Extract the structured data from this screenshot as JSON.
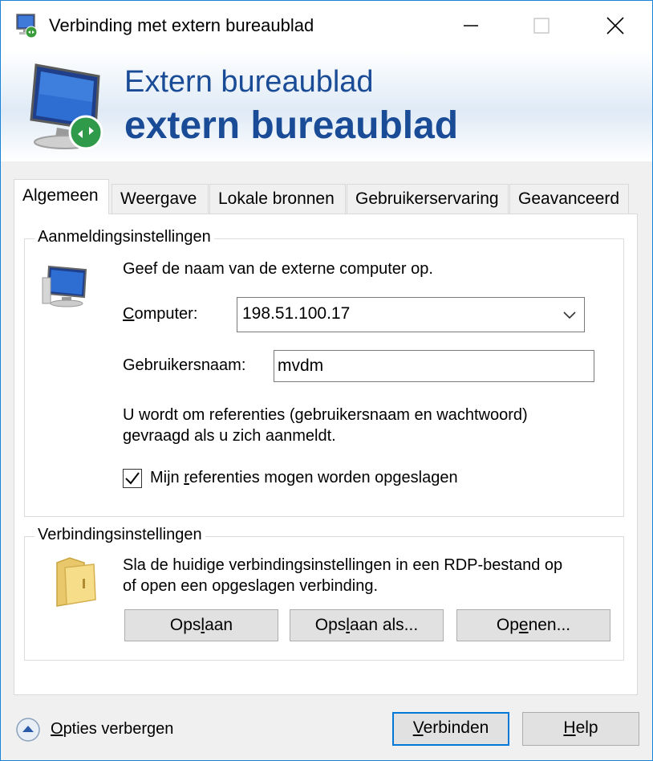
{
  "window": {
    "title": "Verbinding met extern bureaublad"
  },
  "banner": {
    "line1": "Extern bureaublad",
    "line2": "extern bureaublad"
  },
  "tabs": [
    {
      "label": "Algemeen",
      "active": true
    },
    {
      "label": "Weergave",
      "active": false
    },
    {
      "label": "Lokale bronnen",
      "active": false
    },
    {
      "label": "Gebruikerservaring",
      "active": false
    },
    {
      "label": "Geavanceerd",
      "active": false
    }
  ],
  "logon": {
    "group_label": "Aanmeldingsinstellingen",
    "instruction": "Geef de naam van de externe computer op.",
    "computer_label_pre": "",
    "computer_label_u": "C",
    "computer_label_post": "omputer:",
    "computer_value": "198.51.100.17",
    "username_label": "Gebruikersnaam:",
    "username_value": "mvdm",
    "note_line1": "U wordt om referenties (gebruikersnaam en wachtwoord)",
    "note_line2": "gevraagd als u zich aanmeldt.",
    "save_creds_pre": "Mijn ",
    "save_creds_u": "r",
    "save_creds_post": "eferenties mogen worden opgeslagen",
    "save_creds_checked": true
  },
  "connection": {
    "group_label": "Verbindingsinstellingen",
    "desc_line1": "Sla de huidige verbindingsinstellingen in een RDP-bestand op",
    "desc_line2": "of open een opgeslagen verbinding.",
    "save_pre": "Ops",
    "save_u": "l",
    "save_post": "aan",
    "saveas_pre": "Ops",
    "saveas_u": "l",
    "saveas_post": "aan als...",
    "open_pre": "Op",
    "open_u": "e",
    "open_post": "nen..."
  },
  "footer": {
    "options_pre": "",
    "options_u": "O",
    "options_post": "pties verbergen",
    "connect_pre": "",
    "connect_u": "V",
    "connect_post": "erbinden",
    "help_pre": "",
    "help_u": "H",
    "help_post": "elp"
  },
  "colors": {
    "accent": "#0078d7",
    "banner_text": "#1a4b96",
    "window_border": "#1883d7"
  }
}
